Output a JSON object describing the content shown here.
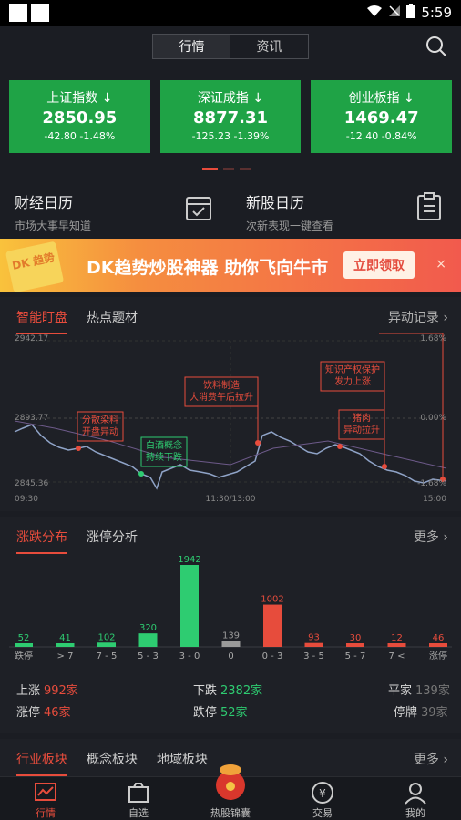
{
  "status": {
    "time": "5:59"
  },
  "topbar": {
    "tabs": [
      "行情",
      "资讯"
    ]
  },
  "indices": [
    {
      "name": "上证指数",
      "value": "2850.95",
      "change": "-42.80",
      "pct": "-1.48%"
    },
    {
      "name": "深证成指",
      "value": "8877.31",
      "change": "-125.23",
      "pct": "-1.39%"
    },
    {
      "name": "创业板指",
      "value": "1469.47",
      "change": "-12.40",
      "pct": "-0.84%"
    }
  ],
  "calendar": [
    {
      "title": "财经日历",
      "sub": "市场大事早知道"
    },
    {
      "title": "新股日历",
      "sub": "次新表现一键查看"
    }
  ],
  "banner": {
    "text": "DK趋势炒股神器 助你飞向牛市",
    "button": "立即领取",
    "badge": "DK 趋势",
    "close": "×"
  },
  "monitor": {
    "tab1": "智能盯盘",
    "tab2": "热点题材",
    "more": "异动记录 ›"
  },
  "chart_labels": {
    "y_top": "2942.17",
    "y_mid": "2893.77",
    "y_bot": "2845.36",
    "pct_top": "1.68%",
    "pct_mid": "0.00%",
    "pct_bot": "-1.68%",
    "x_start": "09:30",
    "x_mid": "11:30/13:00",
    "x_end": "15:00"
  },
  "annotations": [
    {
      "lines": [
        "分散染料",
        "开盘异动"
      ],
      "color": "#e74c3c"
    },
    {
      "lines": [
        "白酒概念",
        "持续下跌"
      ],
      "color": "#2ecc71"
    },
    {
      "lines": [
        "饮料制造",
        "大消费午后拉升"
      ],
      "color": "#e74c3c"
    },
    {
      "lines": [
        "知识产权保护",
        "发力上涨"
      ],
      "color": "#e74c3c"
    },
    {
      "lines": [
        "猪肉",
        "异动拉升"
      ],
      "color": "#e74c3c"
    }
  ],
  "dist": {
    "tab1": "涨跌分布",
    "tab2": "涨停分析",
    "more": "更多 ›"
  },
  "chart_data": {
    "type": "bar",
    "categories": [
      "跌停",
      "> 7",
      "7 - 5",
      "5 - 3",
      "3 - 0",
      "0",
      "0 - 3",
      "3 - 5",
      "5 - 7",
      "7 <",
      "涨停"
    ],
    "values": [
      52,
      41,
      102,
      320,
      1942,
      139,
      1002,
      93,
      30,
      12,
      46
    ],
    "colors": [
      "#2ecc71",
      "#2ecc71",
      "#2ecc71",
      "#2ecc71",
      "#2ecc71",
      "#9a9a9a",
      "#e74c3c",
      "#e74c3c",
      "#e74c3c",
      "#e74c3c",
      "#e74c3c"
    ]
  },
  "stats": {
    "up_label": "上涨",
    "up_val": "992家",
    "down_label": "下跌",
    "down_val": "2382家",
    "flat_label": "平家",
    "flat_val": "139家",
    "limitup_label": "涨停",
    "limitup_val": "46家",
    "limitdown_label": "跌停",
    "limitdown_val": "52家",
    "halt_label": "停牌",
    "halt_val": "39家"
  },
  "sector": {
    "tabs": [
      "行业板块",
      "概念板块",
      "地域板块"
    ],
    "more": "更多 ›"
  },
  "nav": [
    "行情",
    "自选",
    "热股锦囊",
    "交易",
    "我的"
  ]
}
